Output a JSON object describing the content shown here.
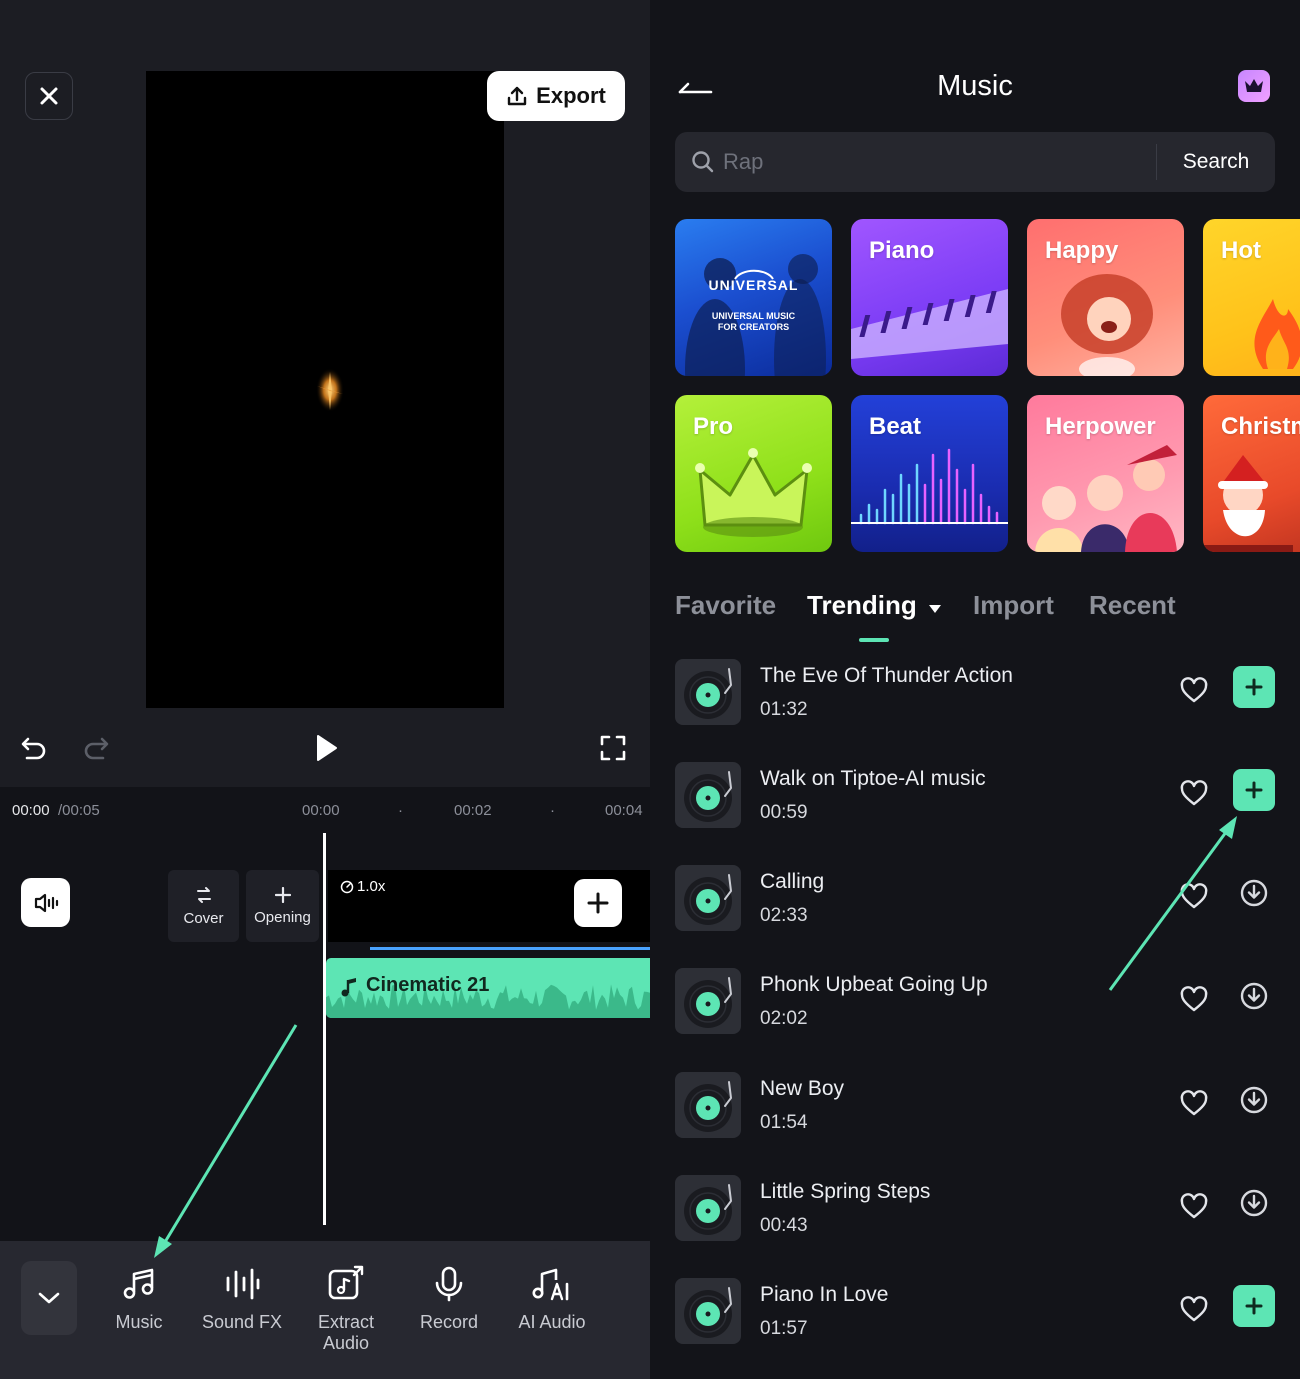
{
  "editor": {
    "export_label": "Export",
    "time_current": "00:00",
    "time_total": "/00:05",
    "ruler": [
      "00:00",
      "00:02",
      "00:04"
    ],
    "cover_label": "Cover",
    "opening_label": "Opening",
    "speed_label": "1.0x",
    "music_clip_label": "Cinematic 21",
    "tools": [
      {
        "label": "Music",
        "icon": "music-note-icon"
      },
      {
        "label": "Sound FX",
        "icon": "sound-fx-icon"
      },
      {
        "label": "Extract\nAudio",
        "icon": "extract-audio-icon"
      },
      {
        "label": "Record",
        "icon": "microphone-icon"
      },
      {
        "label": "AI Audio",
        "icon": "ai-audio-icon"
      }
    ]
  },
  "music": {
    "title": "Music",
    "search_placeholder": "Rap",
    "search_button": "Search",
    "categories": [
      {
        "label": "UNIVERSAL",
        "sub": "UNIVERSAL MUSIC\nFOR CREATORS"
      },
      {
        "label": "Piano"
      },
      {
        "label": "Happy"
      },
      {
        "label": "Hot"
      },
      {
        "label": "Pro"
      },
      {
        "label": "Beat"
      },
      {
        "label": "Herpower"
      },
      {
        "label": "Christmas"
      }
    ],
    "tabs": [
      "Favorite",
      "Trending",
      "Import",
      "Recent"
    ],
    "active_tab": "Trending",
    "songs": [
      {
        "name": "The Eve Of Thunder Action",
        "duration": "01:32",
        "action": "add"
      },
      {
        "name": "Walk on Tiptoe-AI music",
        "duration": "00:59",
        "action": "add"
      },
      {
        "name": "Calling",
        "duration": "02:33",
        "action": "download"
      },
      {
        "name": "Phonk Upbeat Going Up",
        "duration": "02:02",
        "action": "download"
      },
      {
        "name": "New Boy",
        "duration": "01:54",
        "action": "download"
      },
      {
        "name": "Little Spring Steps",
        "duration": "00:43",
        "action": "download"
      },
      {
        "name": "Piano In Love",
        "duration": "01:57",
        "action": "add"
      }
    ]
  },
  "colors": {
    "accent": "#5de5b4",
    "timeline_blue": "#4aa3ff"
  }
}
